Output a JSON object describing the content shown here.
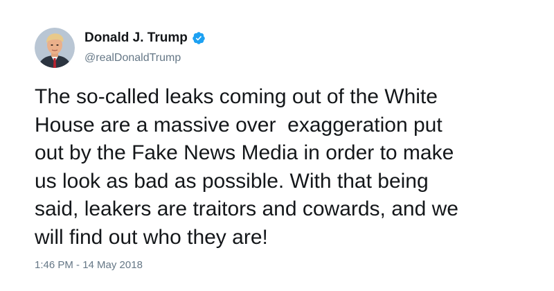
{
  "author": {
    "display_name": "Donald J. Trump",
    "handle": "@realDonaldTrump",
    "verified": true,
    "verified_icon": "verified-badge-icon",
    "avatar_icon": "profile-photo"
  },
  "tweet": {
    "text": "The so-called leaks coming out of the White\nHouse are a massive over  exaggeration put\nout by the Fake News Media in order to make\nus look as bad as possible. With that being\nsaid, leakers are traitors and cowards, and we\nwill find out who they are!",
    "timestamp": "1:46 PM - 14 May 2018"
  },
  "colors": {
    "text_primary": "#14171a",
    "text_secondary": "#657786",
    "verified_blue": "#1da1f2",
    "background": "#ffffff"
  }
}
